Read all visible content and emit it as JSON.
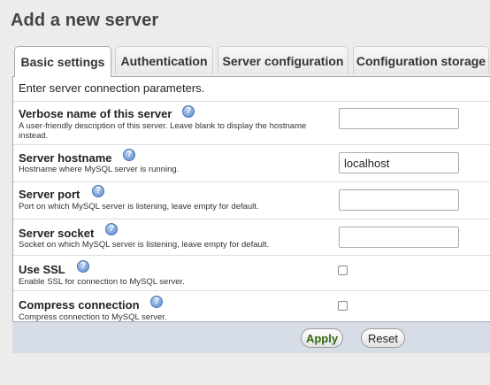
{
  "page": {
    "title": "Add a new server"
  },
  "tabs": [
    {
      "label": "Basic settings",
      "active": true
    },
    {
      "label": "Authentication",
      "active": false
    },
    {
      "label": "Server configuration",
      "active": false
    },
    {
      "label": "Configuration storage",
      "active": false
    }
  ],
  "intro": "Enter server connection parameters.",
  "fields": [
    {
      "label": "Verbose name of this server",
      "description": "A user-friendly description of this server. Leave blank to display the hostname instead.",
      "type": "text",
      "value": ""
    },
    {
      "label": "Server hostname",
      "description": "Hostname where MySQL server is running.",
      "type": "text",
      "value": "localhost"
    },
    {
      "label": "Server port",
      "description": "Port on which MySQL server is listening, leave empty for default.",
      "type": "text",
      "value": ""
    },
    {
      "label": "Server socket",
      "description": "Socket on which MySQL server is listening, leave empty for default.",
      "type": "text",
      "value": ""
    },
    {
      "label": "Use SSL",
      "description": "Enable SSL for connection to MySQL server.",
      "type": "checkbox",
      "checked": false
    },
    {
      "label": "Compress connection",
      "description": "Compress connection to MySQL server.",
      "type": "checkbox",
      "checked": false
    }
  ],
  "buttons": {
    "apply": "Apply",
    "reset": "Reset"
  },
  "icons": {
    "help": "help-icon"
  }
}
